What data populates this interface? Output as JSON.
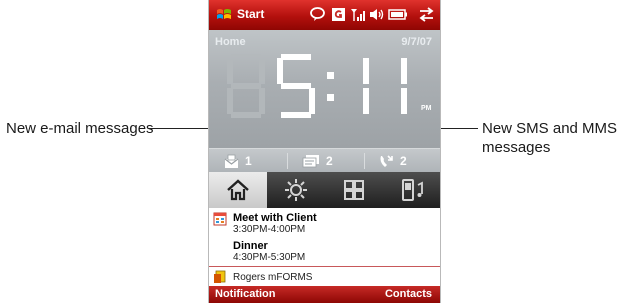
{
  "callouts": {
    "left": "New e-mail messages",
    "right_line1": "New SMS and MMS",
    "right_line2": "messages"
  },
  "titlebar": {
    "start_label": "Start",
    "icons": [
      "notification-bubble-icon",
      "gprs-icon",
      "signal-strength-icon",
      "volume-icon",
      "battery-icon",
      "connectivity-icon"
    ]
  },
  "home": {
    "label": "Home",
    "date": "9/7/07",
    "time": "5:11",
    "ampm": "PM",
    "email_count": "1",
    "sms_count": "2",
    "missed_calls_count": "2"
  },
  "tabs": [
    {
      "name": "home",
      "icon": "home-icon",
      "active": true
    },
    {
      "name": "weather",
      "icon": "weather-sun-icon",
      "active": false
    },
    {
      "name": "launcher",
      "icon": "launcher-grid-icon",
      "active": false
    },
    {
      "name": "sound",
      "icon": "phone-music-icon",
      "active": false
    }
  ],
  "agenda": [
    {
      "title": "Meet with Client",
      "time": "3:30PM-4:00PM"
    },
    {
      "title": "Dinner",
      "time": "4:30PM-5:30PM"
    }
  ],
  "app_item": "Rogers mFORMS",
  "softkeys": {
    "left": "Notification",
    "right": "Contacts"
  },
  "colors": {
    "accent": "#c62a26",
    "home_panel": "#a9aeb2",
    "tab_bar": "#2b2b2b"
  }
}
